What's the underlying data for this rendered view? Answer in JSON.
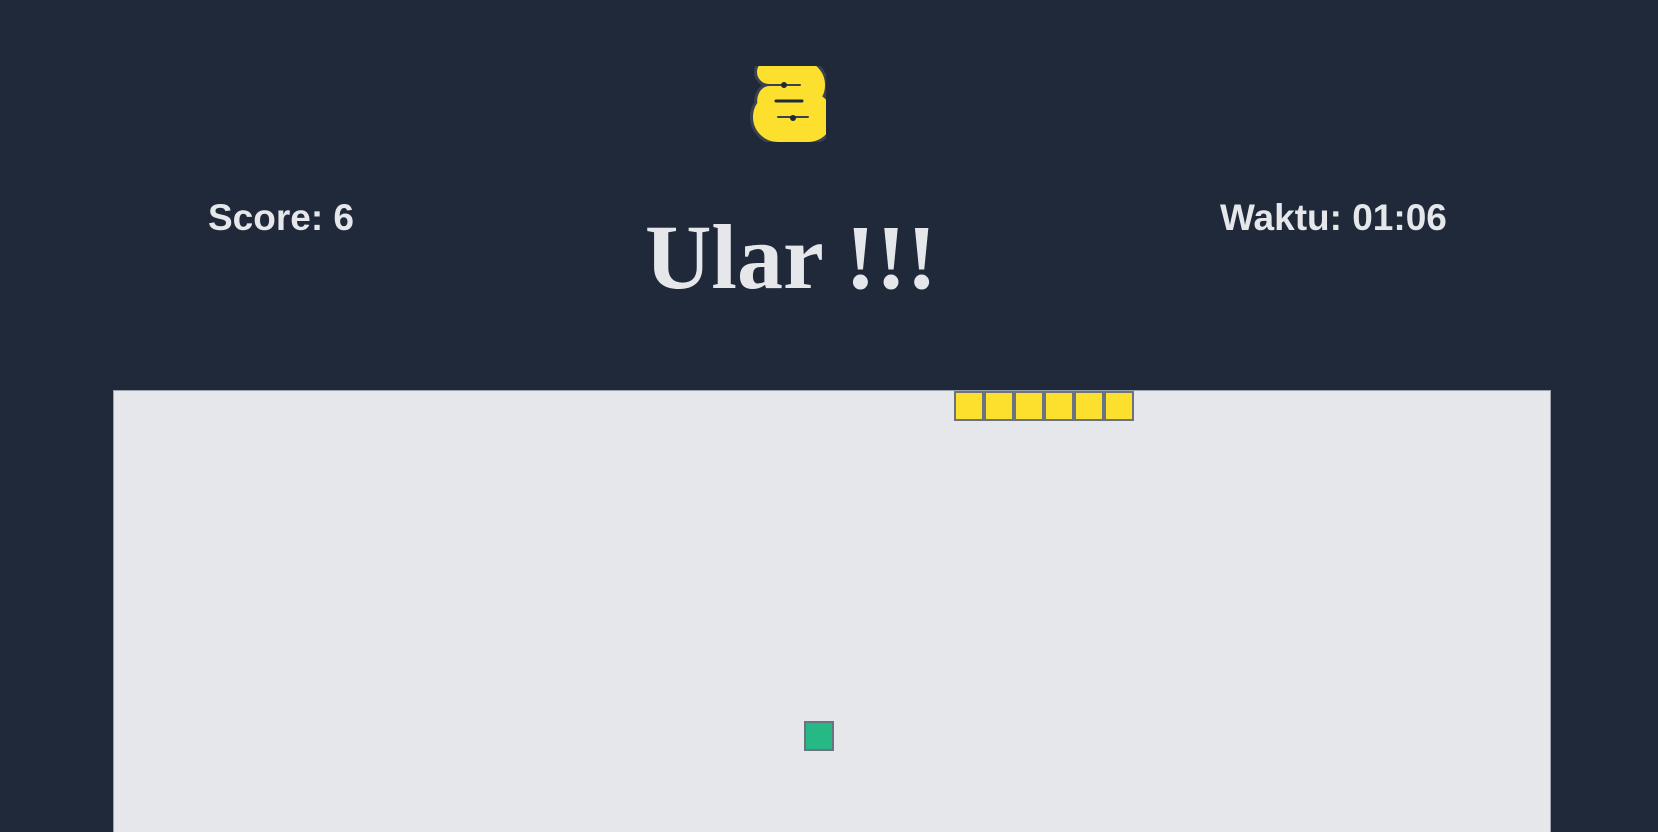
{
  "header": {
    "logo_icon": "python-logo-icon",
    "title": "Ular !!!"
  },
  "stats": {
    "score_label": "Score: 6",
    "score": 6,
    "time_label": "Waktu: 01:06"
  },
  "colors": {
    "background": "#202939",
    "board": "#e5e7eb",
    "snake": "#fde02e",
    "food": "#26b985",
    "text": "#e5e7eb"
  },
  "board": {
    "snake": [
      {
        "col": 28,
        "row": 0
      },
      {
        "col": 29,
        "row": 0
      },
      {
        "col": 30,
        "row": 0
      },
      {
        "col": 31,
        "row": 0
      },
      {
        "col": 32,
        "row": 0
      },
      {
        "col": 33,
        "row": 0
      }
    ],
    "food": {
      "col": 23,
      "row": 11
    }
  }
}
